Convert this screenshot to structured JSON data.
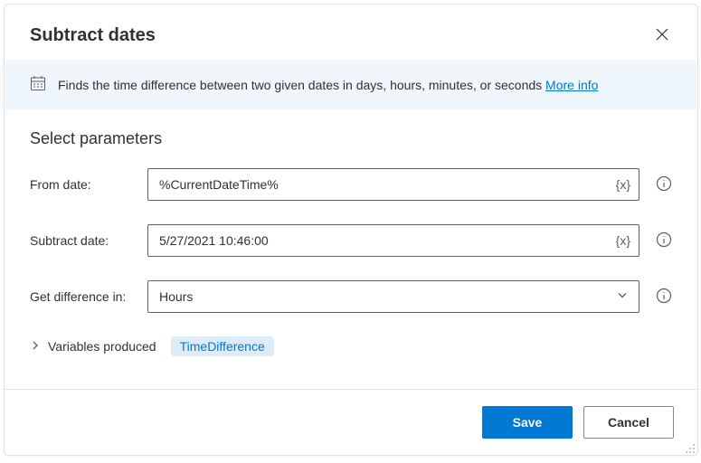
{
  "dialog": {
    "title": "Subtract dates",
    "banner_text": "Finds the time difference between two given dates in days, hours, minutes, or seconds ",
    "more_info": "More info"
  },
  "section": {
    "title": "Select parameters"
  },
  "fields": {
    "from_date": {
      "label": "From date:",
      "value": "%CurrentDateTime%"
    },
    "subtract_date": {
      "label": "Subtract date:",
      "value": "5/27/2021 10:46:00"
    },
    "difference_in": {
      "label": "Get difference in:",
      "value": "Hours"
    },
    "var_token": "{x}"
  },
  "variables": {
    "label": "Variables produced",
    "chip": "TimeDifference"
  },
  "footer": {
    "save": "Save",
    "cancel": "Cancel"
  }
}
